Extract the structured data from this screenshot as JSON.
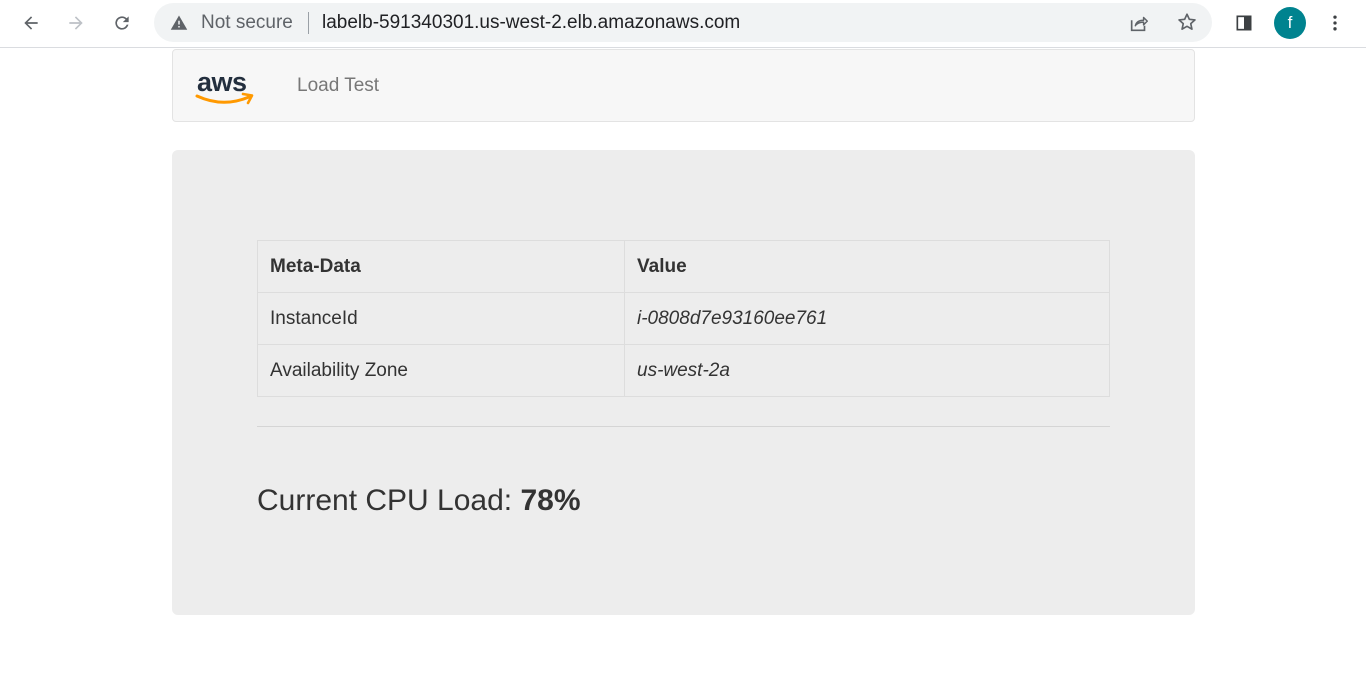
{
  "browser": {
    "security_label": "Not secure",
    "url": "labelb-591340301.us-west-2.elb.amazonaws.com",
    "profile_initial": "f",
    "profile_color": "#00838f"
  },
  "navbar": {
    "logo_text": "aws",
    "brand_title": "Load Test"
  },
  "metadata_table": {
    "headers": [
      "Meta-Data",
      "Value"
    ],
    "rows": [
      {
        "key": "InstanceId",
        "value": "i-0808d7e93160ee761"
      },
      {
        "key": "Availability Zone",
        "value": "us-west-2a"
      }
    ]
  },
  "cpu": {
    "label": "Current CPU Load:",
    "value": "78%"
  },
  "colors": {
    "aws_orange": "#ff9900",
    "aws_dark": "#232f3e"
  }
}
